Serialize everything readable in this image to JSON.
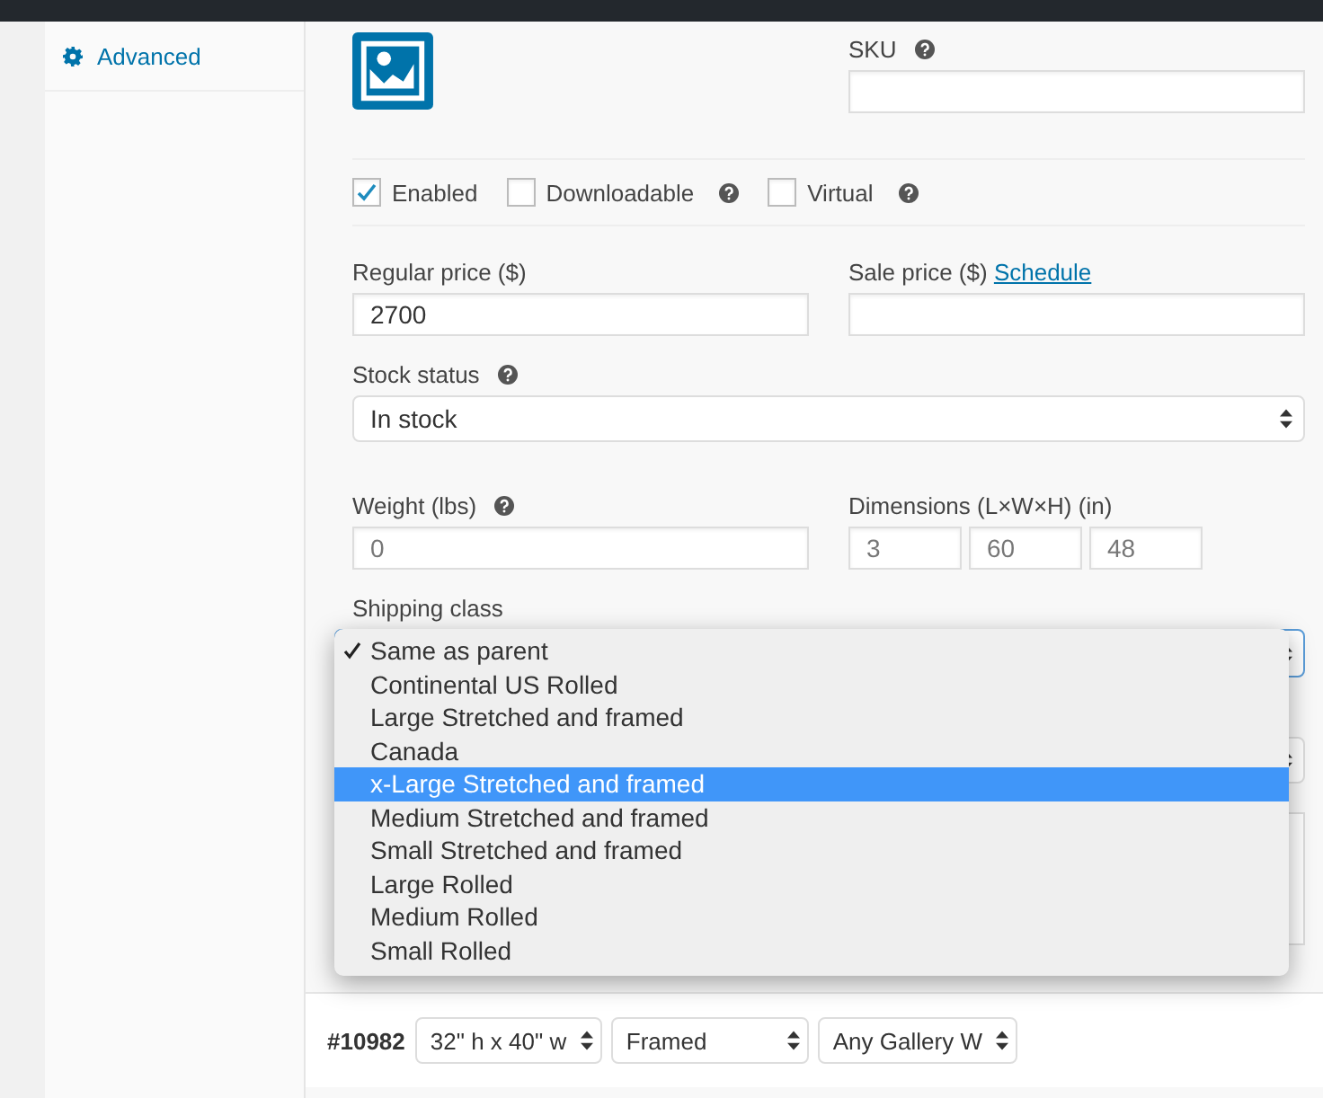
{
  "sidebar": {
    "items": [
      {
        "label": "Advanced"
      }
    ]
  },
  "sku": {
    "label": "SKU",
    "help": true
  },
  "options": [
    {
      "label": "Enabled",
      "checked": true
    },
    {
      "label": "Downloadable",
      "checked": false,
      "help": true
    },
    {
      "label": "Virtual",
      "checked": false,
      "help": true
    }
  ],
  "regular_price": {
    "label": "Regular price ($)",
    "value": "2700"
  },
  "sale_price": {
    "label": "Sale price ($)",
    "link": "Schedule"
  },
  "stock_status": {
    "label": "Stock status",
    "help": true,
    "value": "In stock"
  },
  "weight": {
    "label": "Weight (lbs)",
    "help": true,
    "placeholder": "0"
  },
  "dimensions": {
    "label": "Dimensions (L×W×H) (in)",
    "placeholders": [
      "3",
      "60",
      "48"
    ]
  },
  "shipping_class": {
    "label": "Shipping class",
    "options": [
      {
        "label": "Same as parent",
        "checked": true,
        "selected": false
      },
      {
        "label": "Continental US Rolled",
        "checked": false,
        "selected": false
      },
      {
        "label": "Large Stretched and framed",
        "checked": false,
        "selected": false
      },
      {
        "label": "Canada",
        "checked": false,
        "selected": false
      },
      {
        "label": "x-Large Stretched and framed",
        "checked": false,
        "selected": true
      },
      {
        "label": "Medium Stretched and framed",
        "checked": false,
        "selected": false
      },
      {
        "label": "Small Stretched and framed",
        "checked": false,
        "selected": false
      },
      {
        "label": "Large Rolled",
        "checked": false,
        "selected": false
      },
      {
        "label": "Medium Rolled",
        "checked": false,
        "selected": false
      },
      {
        "label": "Small Rolled",
        "checked": false,
        "selected": false
      }
    ]
  },
  "variation": {
    "number": "#10982",
    "selects": [
      "32\" h x 40\" w",
      "Framed",
      "Any Gallery W"
    ]
  }
}
